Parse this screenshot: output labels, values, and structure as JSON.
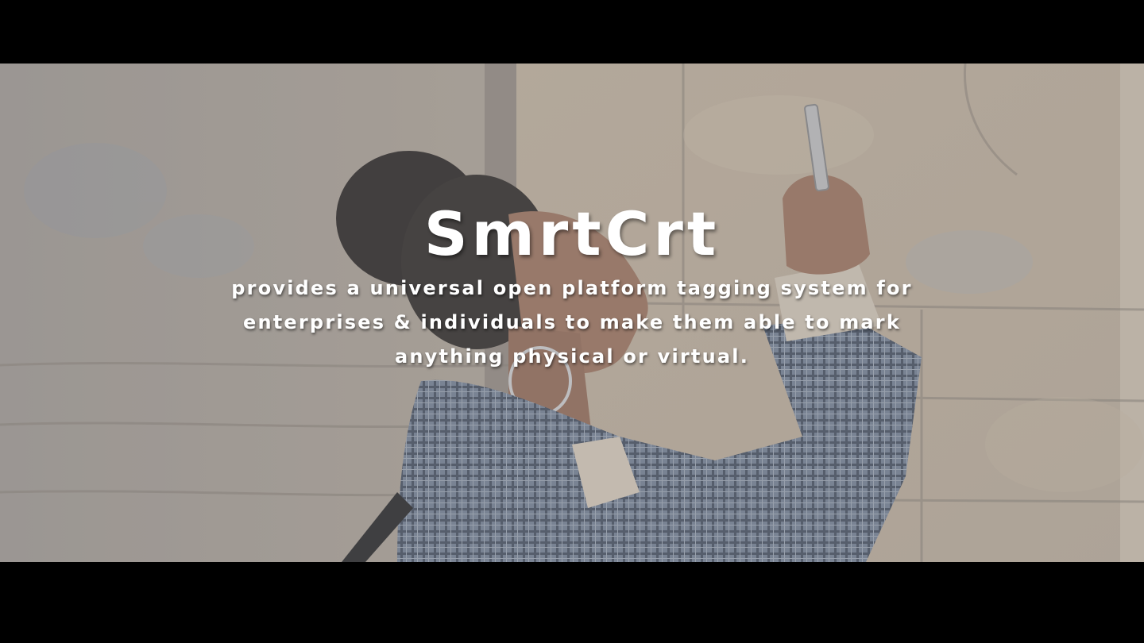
{
  "hero": {
    "title": "SmrtCrt",
    "tagline": "provides a universal open platform tagging system for enterprises & individuals to make them able to mark anything physical or virtual.",
    "background_image": "woman-photographing-stone-wall-with-phone"
  },
  "colors": {
    "letterbox": "#000000",
    "text": "#ffffff",
    "stone": "#c8bba8",
    "coat": "#6f7e93"
  }
}
